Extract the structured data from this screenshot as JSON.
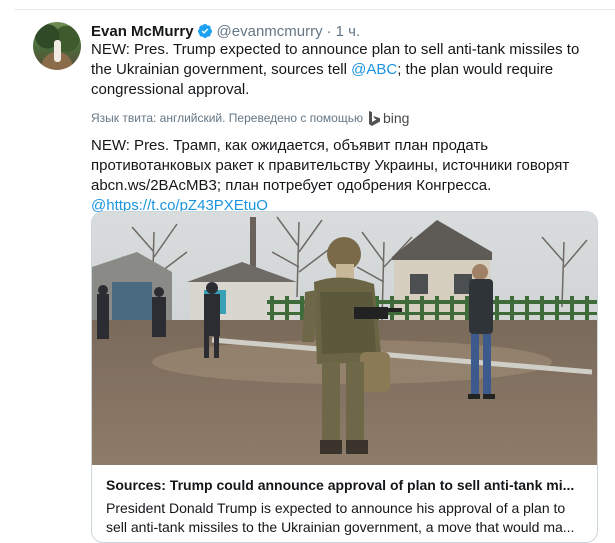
{
  "tweet": {
    "author_name": "Evan McMurry",
    "handle": "@evanmcmurry",
    "separator": "·",
    "time": "1 ч.",
    "text_before": "NEW: Pres. Trump expected to announce plan to sell anti-tank missiles to the Ukrainian government, sources tell ",
    "mention": "@ABC",
    "text_after": "; the plan would require congressional approval.",
    "translation_label": "Язык твита: английский. Переведено с помощью",
    "translator": "bing",
    "translation_text": "NEW: Pres. Трамп, как ожидается, объявит план продать противотанковых ракет к правительству Украины, источники говорят abcn.ws/2BAcMB3; план потребует одобрения Конгресса. ",
    "translation_link": "@https://t.co/pZ43PXEtuO",
    "verified_icon": "verified-badge-icon",
    "colors": {
      "link": "#1b95e0",
      "muted": "#657786",
      "border": "#ccd6dd"
    }
  },
  "card": {
    "image_subject": "soldier-photo",
    "title": "Sources: Trump could announce approval of plan to sell anti-tank mi...",
    "description": "President Donald Trump is expected to announce his approval of a plan to sell anti-tank missiles to the Ukrainian government, a move that would ma..."
  }
}
